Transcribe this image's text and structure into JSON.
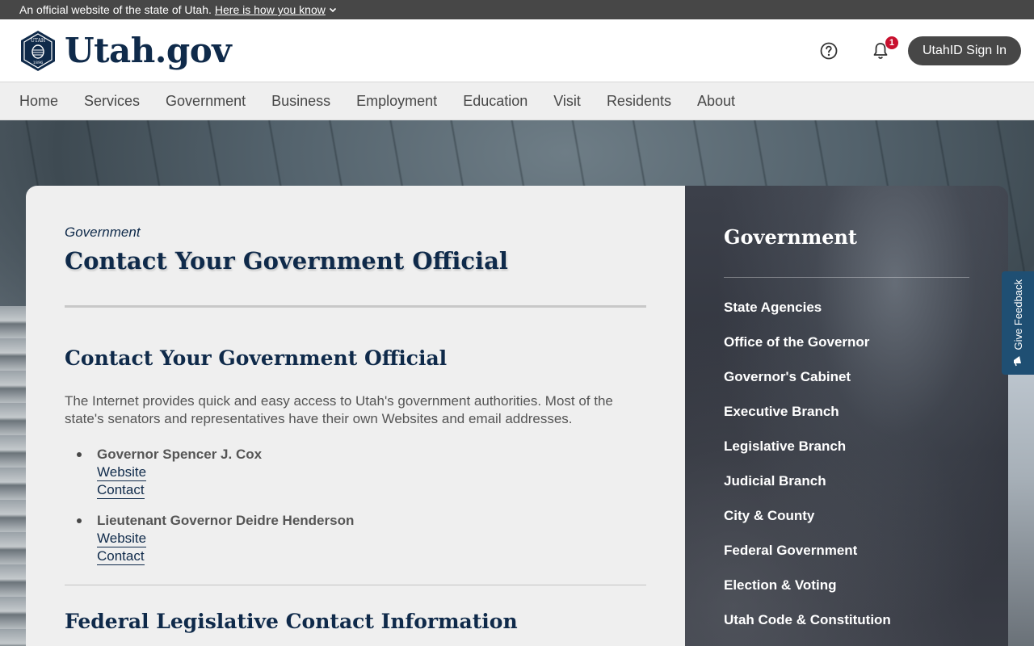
{
  "official_banner": {
    "text": "An official website of the state of Utah.",
    "link": "Here is how you know"
  },
  "header": {
    "logo_text": "Utah.gov",
    "seal_text_top": "UTAH",
    "seal_text_bottom": "1896",
    "notification_count": "1",
    "signin_label": "UtahID Sign In"
  },
  "nav": {
    "items": [
      {
        "label": "Home"
      },
      {
        "label": "Services"
      },
      {
        "label": "Government"
      },
      {
        "label": "Business"
      },
      {
        "label": "Employment"
      },
      {
        "label": "Education"
      },
      {
        "label": "Visit"
      },
      {
        "label": "Residents"
      },
      {
        "label": "About"
      }
    ]
  },
  "main": {
    "breadcrumb": "Government",
    "title": "Contact Your Government Official",
    "section_title": "Contact Your Government Official",
    "intro": "The Internet provides quick and easy access to Utah's government authorities. Most of the state's senators and representatives have their own Websites and email addresses.",
    "officials": [
      {
        "name": "Governor Spencer J. Cox",
        "website": "Website",
        "contact": "Contact"
      },
      {
        "name": "Lieutenant Governor Deidre Henderson",
        "website": "Website",
        "contact": "Contact"
      }
    ],
    "next_section_title": "Federal Legislative Contact Information"
  },
  "sidebar": {
    "title": "Government",
    "items": [
      {
        "label": "State Agencies"
      },
      {
        "label": "Office of the Governor"
      },
      {
        "label": "Governor's Cabinet"
      },
      {
        "label": "Executive Branch"
      },
      {
        "label": "Legislative Branch"
      },
      {
        "label": "Judicial Branch"
      },
      {
        "label": "City & County"
      },
      {
        "label": "Federal Government"
      },
      {
        "label": "Election & Voting"
      },
      {
        "label": "Utah Code & Constitution"
      }
    ]
  },
  "feedback": {
    "label": "Give Feedback"
  },
  "colors": {
    "brand_navy": "#0f2a4a",
    "banner_gray": "#474747",
    "badge_red": "#c8102e",
    "feedback_blue": "#1f4f73"
  }
}
